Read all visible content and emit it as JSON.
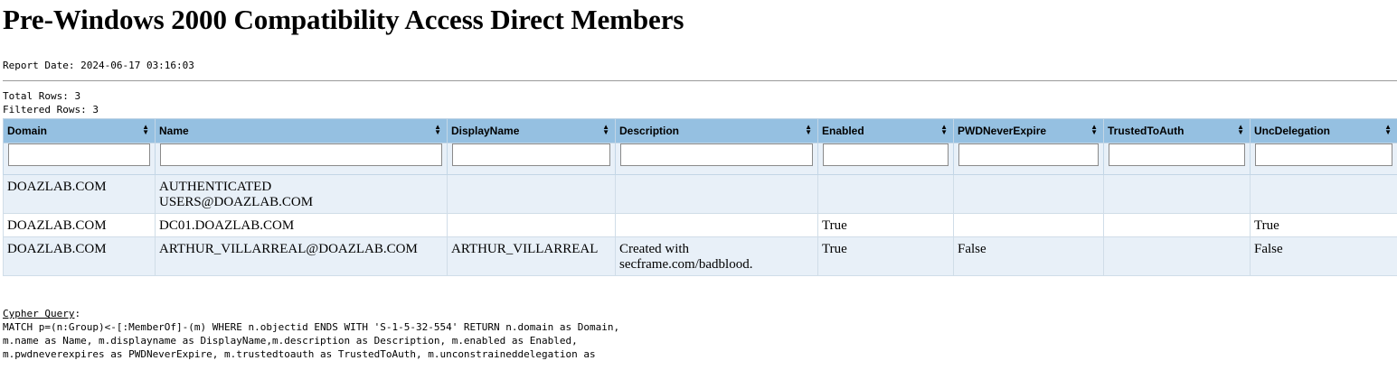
{
  "title": "Pre-Windows 2000 Compatibility Access Direct Members",
  "report_date": "Report Date: 2024-06-17 03:16:03",
  "total_rows": "Total Rows: 3",
  "filtered_rows": "Filtered Rows: 3",
  "columns": [
    "Domain",
    "Name",
    "DisplayName",
    "Description",
    "Enabled",
    "PWDNeverExpire",
    "TrustedToAuth",
    "UncDelegation"
  ],
  "rows": [
    [
      "DOAZLAB.COM",
      "AUTHENTICATED USERS@DOAZLAB.COM",
      "",
      "",
      "",
      "",
      "",
      ""
    ],
    [
      "DOAZLAB.COM",
      "DC01.DOAZLAB.COM",
      "",
      "",
      "True",
      "",
      "",
      "True"
    ],
    [
      "DOAZLAB.COM",
      "ARTHUR_VILLARREAL@DOAZLAB.COM",
      "ARTHUR_VILLARREAL",
      "Created with secframe.com/badblood.",
      "True",
      "False",
      "",
      "False"
    ]
  ],
  "query_label": "Cypher Query",
  "query_lines": [
    "MATCH p=(n:Group)<-[:MemberOf]-(m) WHERE n.objectid ENDS WITH 'S-1-5-32-554' RETURN n.domain as Domain,",
    "m.name as Name, m.displayname as DisplayName,m.description as Description, m.enabled as Enabled,",
    "m.pwdneverexpires as PWDNeverExpire, m.trustedtoauth as TrustedToAuth, m.unconstraineddelegation as"
  ],
  "sort_icon": "sort-updown-icon"
}
